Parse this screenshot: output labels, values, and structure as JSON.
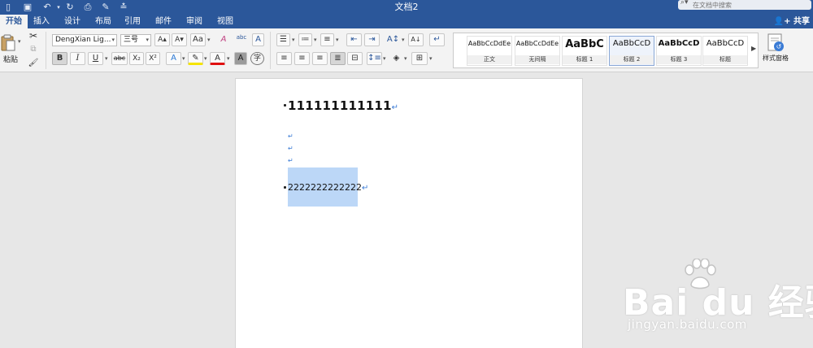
{
  "window": {
    "title": "文档2",
    "search_placeholder": "在文档中搜索",
    "share_label": "共享"
  },
  "tabs": [
    {
      "label": "开始",
      "active": true
    },
    {
      "label": "插入"
    },
    {
      "label": "设计"
    },
    {
      "label": "布局"
    },
    {
      "label": "引用"
    },
    {
      "label": "邮件"
    },
    {
      "label": "审阅"
    },
    {
      "label": "视图"
    }
  ],
  "ribbon": {
    "paste_label": "粘贴",
    "font_name": "DengXian Lig...",
    "font_size": "三号",
    "style_pane_label": "样式窗格",
    "styles": [
      {
        "sample": "AaBbCcDdEe",
        "name": "正文"
      },
      {
        "sample": "AaBbCcDdEe",
        "name": "无间隔"
      },
      {
        "sample": "AaBbC",
        "name": "标题 1"
      },
      {
        "sample": "AaBbCcD",
        "name": "标题 2",
        "selected": true
      },
      {
        "sample": "AaBbCcD",
        "name": "标题 3"
      },
      {
        "sample": "AaBbCcD",
        "name": "标题"
      }
    ],
    "glyphs": {
      "grow": "A▴",
      "shrink": "A▾",
      "case": "Aa",
      "clear": "A",
      "pinyin": "abc",
      "border_char": "A",
      "bold": "B",
      "italic": "I",
      "underline": "U",
      "strike": "abc",
      "sub": "X₂",
      "sup": "X²",
      "effects": "A",
      "highlight": "✎",
      "font_color": "A",
      "shade": "A",
      "enclose": "字"
    }
  },
  "document": {
    "line1": "111111111111",
    "line2": "2222222222222",
    "para_mark": "↵"
  },
  "watermark": {
    "brand": "Bai du 经验",
    "url": "jingyan.baidu.com"
  },
  "colors": {
    "accent": "#2b579a",
    "selection": "#bcd7f7",
    "para_mark": "#3a7bd5",
    "font_color_bar": "#e01010",
    "highlight_bar": "#f5e400"
  }
}
